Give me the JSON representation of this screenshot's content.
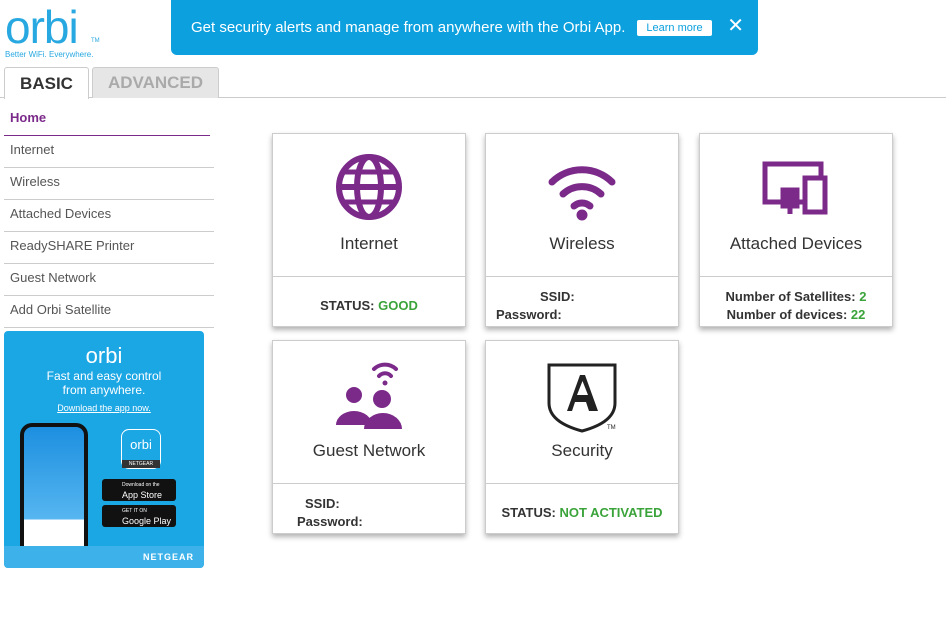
{
  "logo": {
    "word": "orbi",
    "tm": "TM",
    "tagline": "Better WiFi. Everywhere."
  },
  "banner": {
    "text": "Get security alerts and manage from anywhere with the Orbi App.",
    "learn_more": "Learn more",
    "close": "✕"
  },
  "tabs": [
    {
      "label": "BASIC"
    },
    {
      "label": "ADVANCED"
    }
  ],
  "sidebar": {
    "items": [
      {
        "label": "Home"
      },
      {
        "label": "Internet"
      },
      {
        "label": "Wireless"
      },
      {
        "label": "Attached Devices"
      },
      {
        "label": "ReadySHARE Printer"
      },
      {
        "label": "Guest Network"
      },
      {
        "label": "Add Orbi Satellite"
      }
    ]
  },
  "promo": {
    "logo": "orbi",
    "line1": "Fast and easy control",
    "line2": "from anywhere.",
    "download": "Download the app now.",
    "app_icon": "orbi",
    "app_brand": "NETGEAR",
    "appstore_small": "Download on the",
    "appstore": "App Store",
    "play_small": "GET IT ON",
    "play": "Google Play",
    "brand": "NETGEAR"
  },
  "cards": {
    "internet": {
      "title": "Internet",
      "status_label": "STATUS:",
      "status": "GOOD"
    },
    "wireless": {
      "title": "Wireless",
      "ssid_label": "SSID:",
      "password_label": "Password:"
    },
    "devices": {
      "title": "Attached Devices",
      "sat_label": "Number of Satellites:",
      "sat": "2",
      "dev_label": "Number of devices:",
      "dev": "22"
    },
    "guest": {
      "title": "Guest Network",
      "ssid_label": "SSID:",
      "password_label": "Password:"
    },
    "security": {
      "title": "Security",
      "status_label": "STATUS:",
      "status": "NOT ACTIVATED",
      "tm": "TM"
    }
  },
  "colors": {
    "accent": "#7b2a8a",
    "banner": "#0ca0de",
    "good": "#3aa33a"
  }
}
